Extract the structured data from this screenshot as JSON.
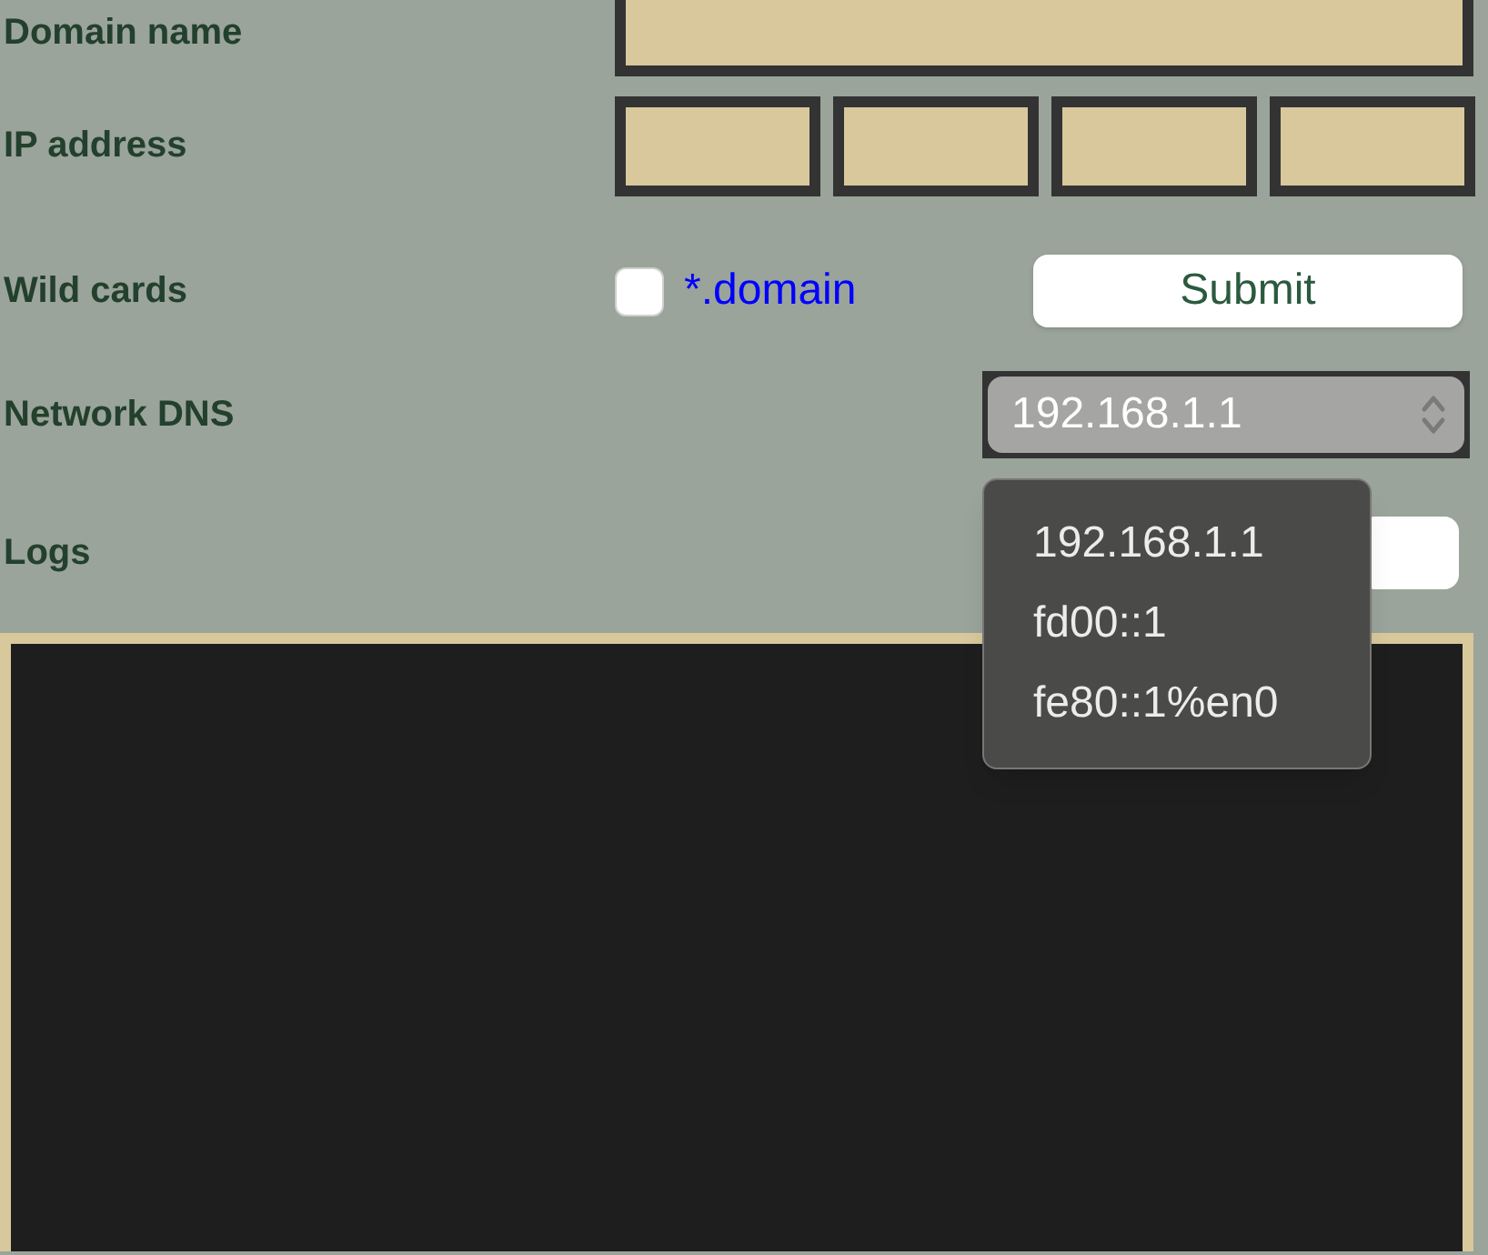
{
  "fields": [
    {
      "kind": "domain",
      "label": "Domain name"
    },
    {
      "kind": "ip",
      "label": "IP address"
    },
    {
      "kind": "wildcard",
      "label": "Wild cards",
      "checkbox": {
        "label": "*.domain",
        "checked": false
      },
      "button": "Submit"
    },
    {
      "kind": "dns",
      "label": "Network DNS",
      "value": "192.168.1.1"
    },
    {
      "kind": "logs",
      "label": "Logs"
    }
  ],
  "dns_menu": {
    "open": true,
    "options": [
      "192.168.1.1",
      "fd00::1",
      "fe80::1%en0"
    ]
  }
}
